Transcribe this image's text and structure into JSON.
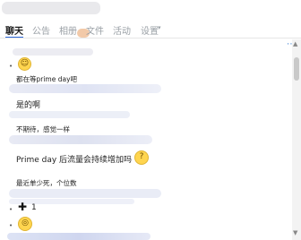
{
  "tabs": [
    {
      "label": "聊天"
    },
    {
      "label": "公告"
    },
    {
      "label": "相册"
    },
    {
      "label": "文件"
    },
    {
      "label": "活动"
    },
    {
      "label": "设置"
    }
  ],
  "settings_dropdown_icon": "chevron-down-icon",
  "messages": [
    {
      "text": "都在等prime day吧"
    },
    {
      "text": "是的啊"
    },
    {
      "text": "不期待，感觉一样"
    },
    {
      "text": "Prime day  后流量会持续增加吗"
    },
    {
      "text": "最近单少死，个位数"
    },
    {
      "text": "1"
    }
  ],
  "colors": {
    "accent": "#2c67d8",
    "tab_inactive": "#9aa0a6"
  }
}
